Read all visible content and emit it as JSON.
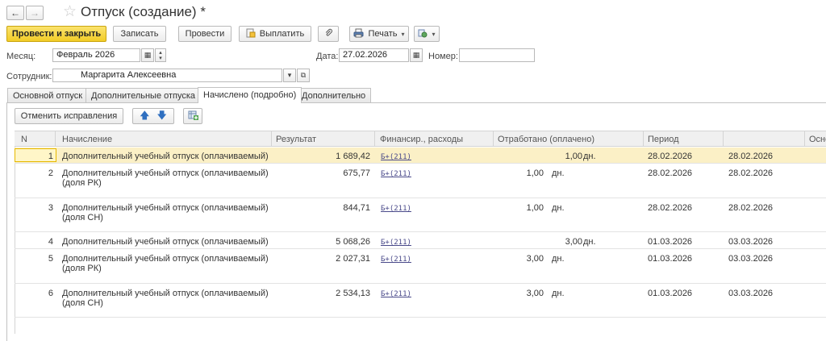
{
  "window": {
    "title": "Отпуск (создание) *"
  },
  "toolbar": {
    "post_close_label": "Провести и закрыть",
    "save_label": "Записать",
    "post_label": "Провести",
    "pay_label": "Выплатить",
    "print_label": "Печать"
  },
  "header": {
    "month_label": "Месяц:",
    "month_value": "Февраль 2026",
    "date_label": "Дата:",
    "date_value": "27.02.2026",
    "number_label": "Номер:",
    "number_value": "",
    "employee_label": "Сотрудник:",
    "employee_value": "Маргарита Алексеевна"
  },
  "tabs": [
    {
      "label": "Основной отпуск",
      "active": false
    },
    {
      "label": "Дополнительные отпуска",
      "active": false
    },
    {
      "label": "Начислено (подробно)",
      "active": true
    },
    {
      "label": "Дополнительно",
      "active": false
    }
  ],
  "panel": {
    "cancel_corrections_label": "Отменить исправления"
  },
  "table": {
    "columns": {
      "n": "N",
      "accrual": "Начисление",
      "result": "Результат",
      "finance": "Финансир., расходы",
      "worked": "Отработано (оплачено)",
      "period": "Период",
      "extra": "Осно"
    },
    "rows": [
      {
        "n": "1",
        "accrual": "Дополнительный учебный отпуск (оплачиваемый)",
        "result": "1 689,42",
        "finance": "Б+(211)",
        "worked": "1,00",
        "unit": "дн.",
        "from": "28.02.2026",
        "to": "28.02.2026"
      },
      {
        "n": "2",
        "accrual": "Дополнительный учебный отпуск (оплачиваемый) (доля РК)",
        "result": "675,77",
        "finance": "Б+(211)",
        "worked": "1,00",
        "unit": "дн.",
        "from": "28.02.2026",
        "to": "28.02.2026"
      },
      {
        "n": "3",
        "accrual": "Дополнительный учебный отпуск (оплачиваемый) (доля СН)",
        "result": "844,71",
        "finance": "Б+(211)",
        "worked": "1,00",
        "unit": "дн.",
        "from": "28.02.2026",
        "to": "28.02.2026"
      },
      {
        "n": "4",
        "accrual": "Дополнительный учебный отпуск (оплачиваемый)",
        "result": "5 068,26",
        "finance": "Б+(211)",
        "worked": "3,00",
        "unit": "дн.",
        "from": "01.03.2026",
        "to": "03.03.2026"
      },
      {
        "n": "5",
        "accrual": "Дополнительный учебный отпуск (оплачиваемый) (доля РК)",
        "result": "2 027,31",
        "finance": "Б+(211)",
        "worked": "3,00",
        "unit": "дн.",
        "from": "01.03.2026",
        "to": "03.03.2026"
      },
      {
        "n": "6",
        "accrual": "Дополнительный учебный отпуск (оплачиваемый) (доля СН)",
        "result": "2 534,13",
        "finance": "Б+(211)",
        "worked": "3,00",
        "unit": "дн.",
        "from": "01.03.2026",
        "to": "03.03.2026"
      }
    ]
  }
}
